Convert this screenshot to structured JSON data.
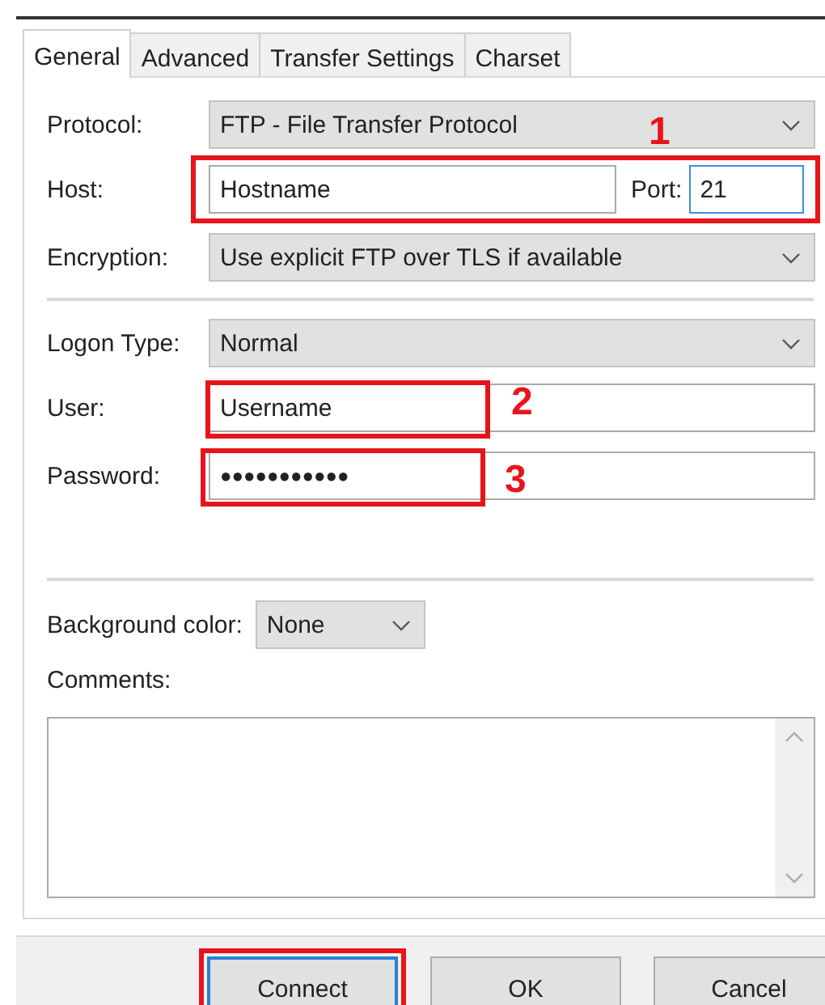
{
  "tabs": [
    {
      "label": "General",
      "selected": true
    },
    {
      "label": "Advanced",
      "selected": false
    },
    {
      "label": "Transfer Settings",
      "selected": false
    },
    {
      "label": "Charset",
      "selected": false
    }
  ],
  "protocol": {
    "label": "Protocol:",
    "value": "FTP - File Transfer Protocol"
  },
  "host": {
    "label": "Host:",
    "value": "Hostname",
    "port_label": "Port:",
    "port_value": "21",
    "port_focused": true,
    "highlighted": true,
    "marker": "1"
  },
  "encryption": {
    "label": "Encryption:",
    "value": "Use explicit FTP over TLS if available"
  },
  "logon_type": {
    "label": "Logon Type:",
    "value": "Normal"
  },
  "user": {
    "label": "User:",
    "value": "Username",
    "highlighted": true,
    "marker": "2"
  },
  "password": {
    "label": "Password:",
    "value": "●●●●●●●●●●●",
    "highlighted": true,
    "marker": "3"
  },
  "background_color": {
    "label": "Background color:",
    "value": "None"
  },
  "comments": {
    "label": "Comments:"
  },
  "buttons": [
    {
      "label": "Connect",
      "default": true,
      "highlighted": true
    },
    {
      "label": "OK",
      "default": false,
      "highlighted": false
    },
    {
      "label": "Cancel",
      "default": false,
      "highlighted": false
    }
  ]
}
